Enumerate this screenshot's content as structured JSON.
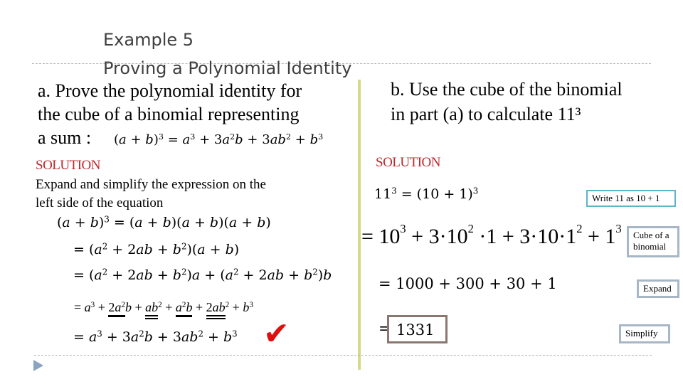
{
  "slide": {
    "title_line1": "Example 5",
    "title_line2": "Proving a Polynomial Identity"
  },
  "part_a": {
    "prompt_line1": "a. Prove the polynomial identity for",
    "prompt_line2": "the cube of a binomial representing",
    "prompt_line3": "a sum :",
    "identity": "(a + b)³ = a³ + 3a²b + 3ab² + b³",
    "solution_label": "SOLUTION",
    "instruction_line1": "Expand and simplify the expression on the",
    "instruction_line2": "left side of the equation",
    "steps": [
      "(a + b)³ = (a + b)(a + b)(a + b)",
      "= (a² + 2ab + b²)(a + b)",
      "= (a² + 2ab + b²)a + (a² + 2ab + b²)b",
      "= a³ + 2a²b + ab² + a²b + 2ab² + b³",
      "= a³ + 3a²b + 3ab² + b³"
    ],
    "check_mark": "✔"
  },
  "part_b": {
    "prompt_line1": "b. Use the cube of the binomial",
    "prompt_line2": "in part (a) to calculate 11³",
    "solution_label": "SOLUTION",
    "steps": [
      "11³ = (10 + 1)³",
      "= 10³ + 3·10²·1 + 3·10·1² + 1³",
      "= 1000 + 300 + 30 + 1",
      "= 1331"
    ],
    "answer": "1331",
    "notes": [
      "Write 11 as 10 + 1",
      "Cube of a binomial",
      "Expand",
      "Simplify"
    ]
  },
  "colors": {
    "title": "#3f3f3f",
    "solution": "#c0262b",
    "divider": "#d6d88a",
    "note_border": "#a7b7c6",
    "note_border_teal": "#5fb4c6",
    "answer_border": "#8a7770",
    "check": "#e01010",
    "bullet": "#8aa3c2"
  }
}
